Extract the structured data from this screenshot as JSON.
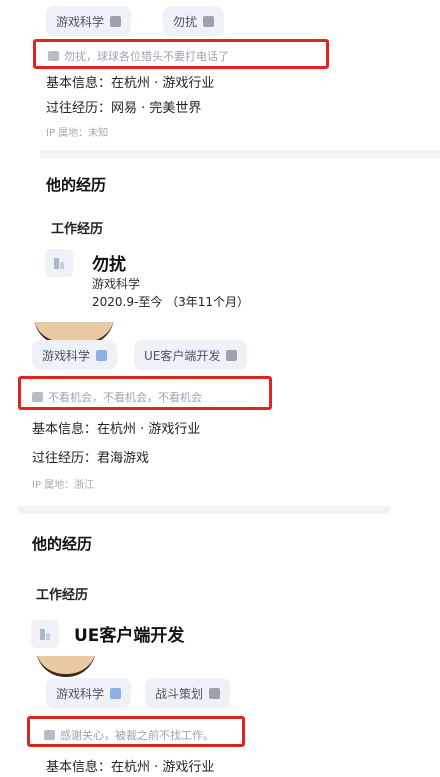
{
  "profiles": [
    {
      "tags": [
        {
          "label": "游戏科学",
          "icon": "badge-icon"
        },
        {
          "label": "勿扰",
          "icon": "badge-icon"
        }
      ],
      "slogan": "勿扰，球球各位猎头不要打电话了",
      "basic_info": "基本信息：在杭州 · 游戏行业",
      "past_experience": "过往经历：网易 · 完美世界",
      "ip_location": "IP 属地：未知",
      "section_title": "他的经历",
      "work_header": "工作经历",
      "job": {
        "title": "勿扰",
        "company": "游戏科学",
        "period": "2020.9-至今 （3年11个月）"
      }
    },
    {
      "tags": [
        {
          "label": "游戏科学",
          "icon": "edit-icon"
        },
        {
          "label": "UE客户端开发",
          "icon": "badge-icon"
        }
      ],
      "slogan": "不看机会，不看机会，不看机会",
      "basic_info": "基本信息：在杭州 · 游戏行业",
      "past_experience": "过往经历：君海游戏",
      "ip_location": "IP 属地：浙江",
      "section_title": "他的经历",
      "work_header": "工作经历",
      "job": {
        "title": "UE客户端开发"
      }
    },
    {
      "tags": [
        {
          "label": "游戏科学",
          "icon": "edit-icon"
        },
        {
          "label": "战斗策划",
          "icon": "badge-icon"
        }
      ],
      "slogan": "感谢关心，被裁之前不找工作。",
      "basic_info": "基本信息：在杭州 · 游戏行业"
    }
  ],
  "colors": {
    "highlight_border": "#e02420",
    "chip_bg": "#eef1f6",
    "muted_text": "#9ca3af"
  }
}
